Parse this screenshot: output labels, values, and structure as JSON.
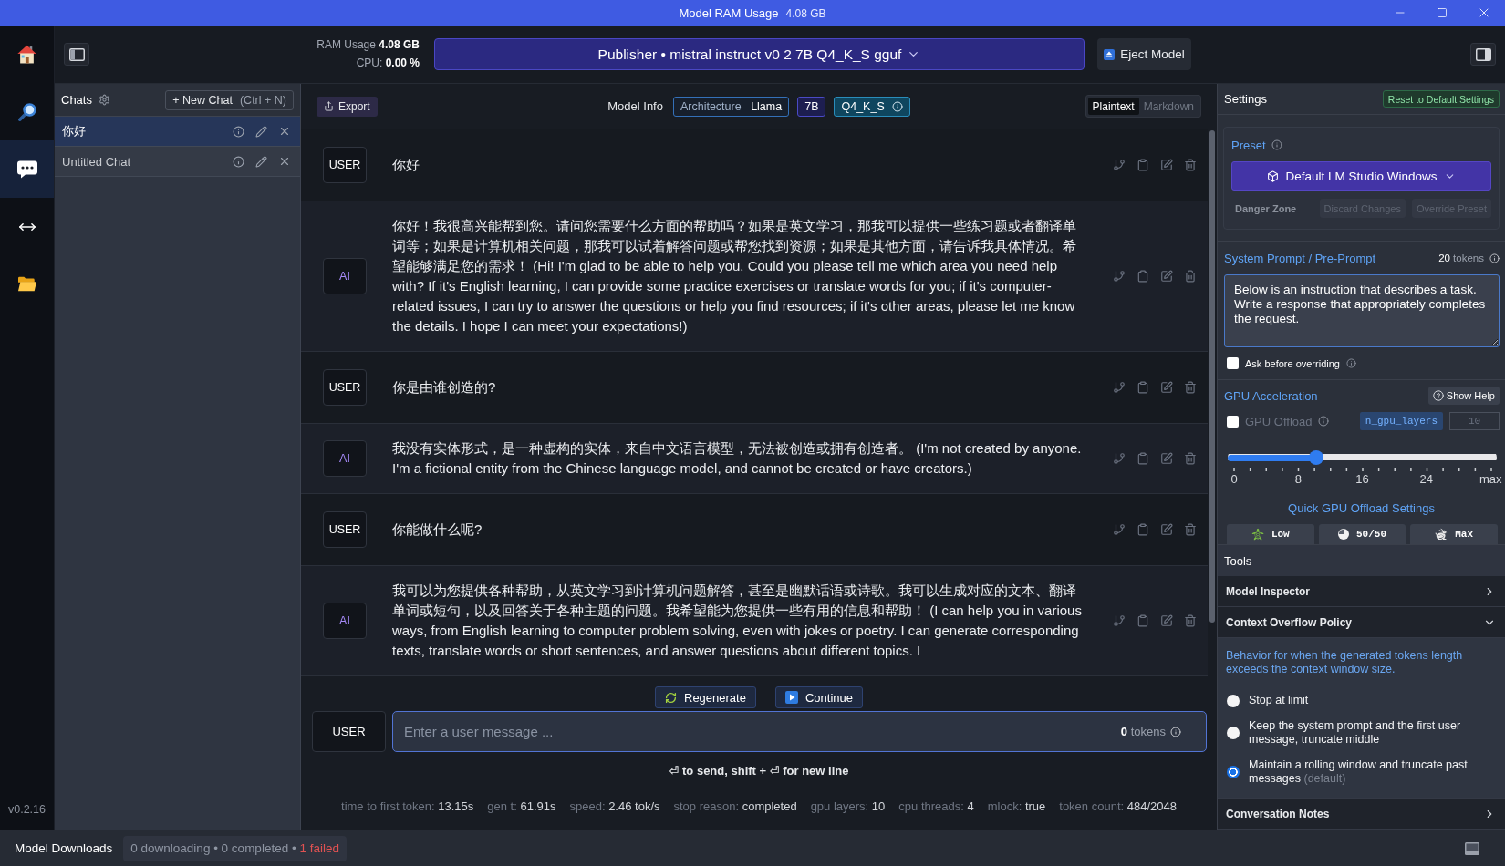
{
  "window": {
    "title": "Model RAM Usage",
    "title_value": "4.08 GB"
  },
  "nav": {
    "items": [
      {
        "kind": "home",
        "selected": false
      },
      {
        "kind": "search",
        "selected": false
      },
      {
        "kind": "chat",
        "selected": true
      },
      {
        "kind": "arrows",
        "selected": false
      },
      {
        "kind": "folder",
        "selected": false
      }
    ],
    "version": "v0.2.16"
  },
  "header": {
    "ram": "RAM Usage **4.08 GB**",
    "cpu": "CPU: **0.00 %**",
    "model_selector": "Publisher • mistral instruct v0 2 7B Q4_K_S gguf",
    "eject_button": "Eject Model"
  },
  "chats": {
    "title": "Chats",
    "new_chat": {
      "label": "+ New Chat",
      "shortcut": "(Ctrl + N)"
    },
    "items": [
      {
        "title": "你好",
        "selected": true
      },
      {
        "title": "Untitled Chat",
        "selected": false
      }
    ]
  },
  "toolbar": {
    "export_button": "Export",
    "model_info": {
      "label": "Model Info",
      "chips": [
        {
          "kind": "pair",
          "label": "Architecture",
          "value": "Llama"
        },
        {
          "kind": "size",
          "label": "7B"
        },
        {
          "kind": "quant",
          "label": "Q4_K_S"
        }
      ]
    },
    "format_tabs": [
      {
        "label": "Plaintext",
        "selected": true
      },
      {
        "label": "Markdown",
        "selected": false
      }
    ]
  },
  "messages": [
    {
      "kind": "user",
      "role": "USER",
      "text": "你好"
    },
    {
      "kind": "ai",
      "role": "AI",
      "text": "你好！我很高兴能帮到您。请问您需要什么方面的帮助吗？如果是英文学习，那我可以提供一些练习题或者翻译单词等；如果是计算机相关问题，那我可以试着解答问题或帮您找到资源；如果是其他方面，请告诉我具体情况。希望能够满足您的需求！ (Hi! I'm glad to be able to help you. Could you please tell me which area you need help with? If it's English learning, I can provide some practice exercises or translate words for you; if it's computer-related issues, I can try to answer the questions or help you find resources; if it's other areas, please let me know the details. I hope I can meet your expectations!)"
    },
    {
      "kind": "user",
      "role": "USER",
      "text": "你是由谁创造的?"
    },
    {
      "kind": "ai",
      "role": "AI",
      "text": "我没有实体形式，是一种虚构的实体，来自中文语言模型，无法被创造或拥有创造者。 (I'm not created by anyone. I'm a fictional entity from the Chinese language model, and cannot be created or have creators.)"
    },
    {
      "kind": "user",
      "role": "USER",
      "text": "你能做什么呢?"
    },
    {
      "kind": "ai",
      "role": "AI",
      "text": "我可以为您提供各种帮助，从英文学习到计算机问题解答，甚至是幽默话语或诗歌。我可以生成对应的文本、翻译单词或短句，以及回答关于各种主题的问题。我希望能为您提供一些有用的信息和帮助！ (I can help you in various ways, from English learning to computer problem solving, even with jokes or poetry. I can generate corresponding texts, translate words or short sentences, and answer questions about different topics. I"
    }
  ],
  "message_actions": {
    "regenerate": "Regenerate",
    "continue": "Continue"
  },
  "composer": {
    "role": "USER",
    "placeholder": "Enter a user message ...",
    "tokens": "**0** tokens",
    "hint": "⏎ to send, shift + ⏎ for new line"
  },
  "stats": [
    "time to first token: **13.15s**",
    "gen t: **61.91s**",
    "speed: **2.46 tok/s**",
    "stop reason: **completed**",
    "gpu layers: **10**",
    "cpu threads: **4**",
    "mlock: **true**",
    "token count: **484/2048**"
  ],
  "settings": {
    "title": "Settings",
    "reset_button": "Reset to Default Settings",
    "preset": {
      "label": "Preset",
      "selector": "Default LM Studio Windows",
      "danger_label": "Danger Zone",
      "buttons": [
        {
          "label": "Discard Changes",
          "disabled": true
        },
        {
          "label": "Override Preset",
          "disabled": true
        }
      ]
    },
    "system_prompt": {
      "label": "System Prompt / Pre-Prompt",
      "tokens": "**20** tokens",
      "value": "Below is an instruction that describes a task. Write a response that appropriately completes the request.",
      "ask_before_overriding": {
        "label": "Ask before overriding",
        "checked": false
      }
    },
    "gpu": {
      "label": "GPU Acceleration",
      "help_button": "Show Help",
      "offload": {
        "label": "GPU Offload",
        "checked": false
      },
      "param": "n_gpu_layers",
      "param_value": "10",
      "slider": {
        "level": 0.32,
        "tick_labels": [
          "0",
          "8",
          "16",
          "24",
          "max"
        ]
      },
      "quick_title": "Quick GPU Offload Settings",
      "quick_buttons": [
        {
          "kind": "turtle",
          "label": "Low"
        },
        {
          "kind": "half",
          "label": "50/50"
        },
        {
          "kind": "rabbit",
          "label": "Max"
        }
      ]
    }
  },
  "tools": {
    "title": "Tools",
    "sections": [
      {
        "title": "Model Inspector",
        "expanded": false
      },
      {
        "title": "Context Overflow Policy",
        "expanded": true,
        "description": "Behavior for when the generated tokens length exceeds the context window size.",
        "options": [
          {
            "label": "Stop at limit",
            "selected": false
          },
          {
            "label": "Keep the system prompt and the first user message, truncate middle",
            "selected": false
          },
          {
            "label": "Maintain a rolling window and truncate past messages",
            "note": "(default)",
            "selected": true
          }
        ]
      },
      {
        "title": "Conversation Notes",
        "expanded": false
      }
    ]
  },
  "status_bar": {
    "title": "Model Downloads",
    "summary": "0 downloading • 0 completed •",
    "failed": "1 failed"
  }
}
